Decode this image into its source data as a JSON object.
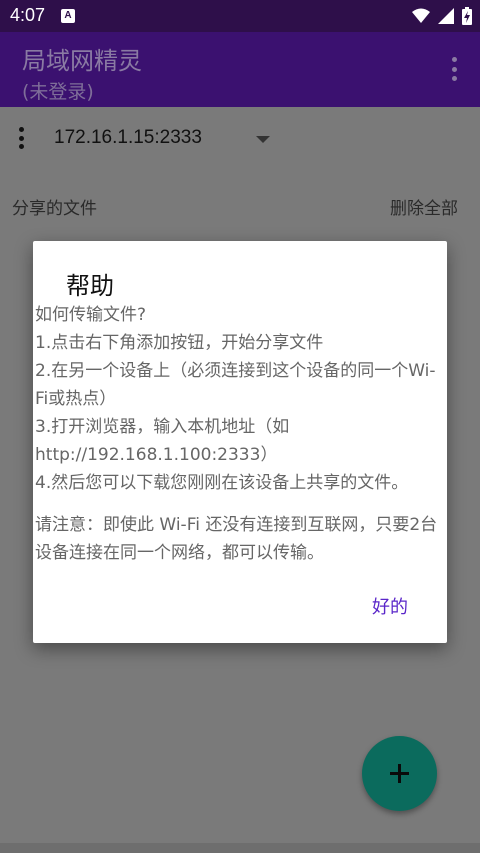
{
  "status_bar": {
    "time": "4:07",
    "notification_icon": "a-icon",
    "icons": [
      "wifi-icon",
      "cellular-icon",
      "battery-charging-icon"
    ]
  },
  "app_bar": {
    "title": "局域网精灵",
    "subtitle": "(未登录)",
    "menu_icon": "more-vert-icon"
  },
  "server": {
    "address": "172.16.1.15:2333",
    "menu_icon": "more-vert-icon",
    "dropdown_icon": "arrow-drop-down-icon"
  },
  "files": {
    "shared_label": "分享的文件",
    "delete_all_label": "删除全部"
  },
  "fab": {
    "icon": "add-icon"
  },
  "dialog": {
    "title": "帮助",
    "lines": [
      "如何传输文件?",
      "1.点击右下角添加按钮，开始分享文件",
      "2.在另一个设备上（必须连接到这个设备的同一个Wi-Fi或热点）",
      "3.打开浏览器，输入本机地址（如http://192.168.1.100:2333）",
      "4.然后您可以下载您刚刚在该设备上共享的文件。"
    ],
    "note": "请注意：即使此 Wi-Fi 还没有连接到互联网，只要2台设备连接在同一个网络，都可以传输。",
    "ok_label": "好的"
  },
  "colors": {
    "status_bar": "#2e0f4a",
    "app_bar": "#3b1170",
    "accent": "#5a26c9",
    "fab": "#0b6b5d"
  }
}
